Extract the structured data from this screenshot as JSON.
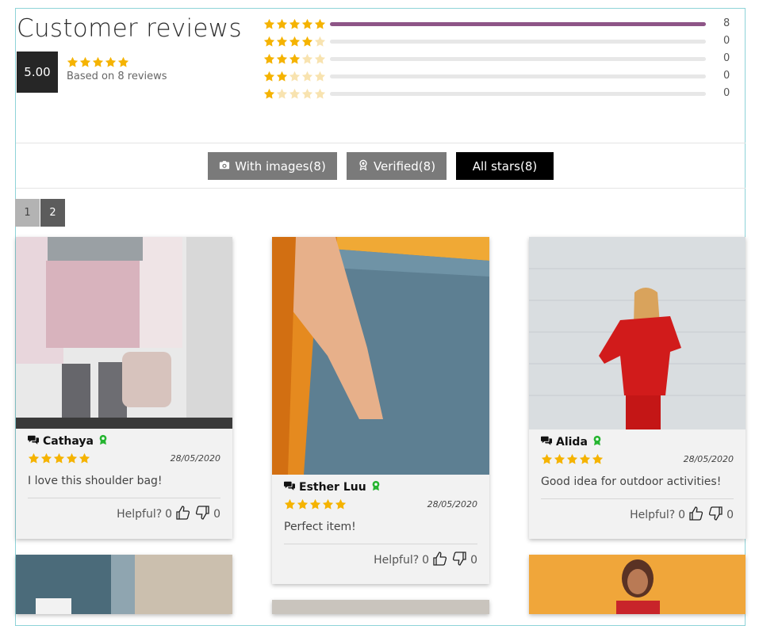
{
  "header": {
    "title": "Customer reviews",
    "average": "5.00",
    "based_on": "Based on 8 reviews",
    "average_stars": 5
  },
  "histogram": [
    {
      "stars": 5,
      "count": "8",
      "fraction": 1.0
    },
    {
      "stars": 4,
      "count": "0",
      "fraction": 0
    },
    {
      "stars": 3,
      "count": "0",
      "fraction": 0
    },
    {
      "stars": 2,
      "count": "0",
      "fraction": 0
    },
    {
      "stars": 1,
      "count": "0",
      "fraction": 0
    }
  ],
  "filters": {
    "with_images": "With images(8)",
    "verified": "Verified(8)",
    "all_stars": "All stars(8)"
  },
  "pagination": {
    "page1": "1",
    "page2": "2"
  },
  "reviews": [
    {
      "name": "Cathaya",
      "date": "28/05/2020",
      "text": "I love this shoulder bag!",
      "helpful_label": "Helpful?",
      "up": "0",
      "down": "0",
      "rating": 5
    },
    {
      "name": "Esther Luu",
      "date": "28/05/2020",
      "text": "Perfect item!",
      "helpful_label": "Helpful?",
      "up": "0",
      "down": "0",
      "rating": 5
    },
    {
      "name": "Alida",
      "date": "28/05/2020",
      "text": "Good idea for outdoor activities!",
      "helpful_label": "Helpful?",
      "up": "0",
      "down": "0",
      "rating": 5
    }
  ],
  "colors": {
    "star": "#f5b301",
    "star_empty": "#f8e3b0",
    "bar_fill": "#8e5587",
    "bar_empty": "#e7e7e7",
    "verified_green": "#26b531",
    "accent_dark": "#262626"
  },
  "icons": {
    "chat": "chat-bubbles-icon",
    "verified": "verified-ribbon-icon",
    "camera": "camera-icon",
    "thumbs_up": "thumbs-up-icon",
    "thumbs_down": "thumbs-down-icon"
  }
}
